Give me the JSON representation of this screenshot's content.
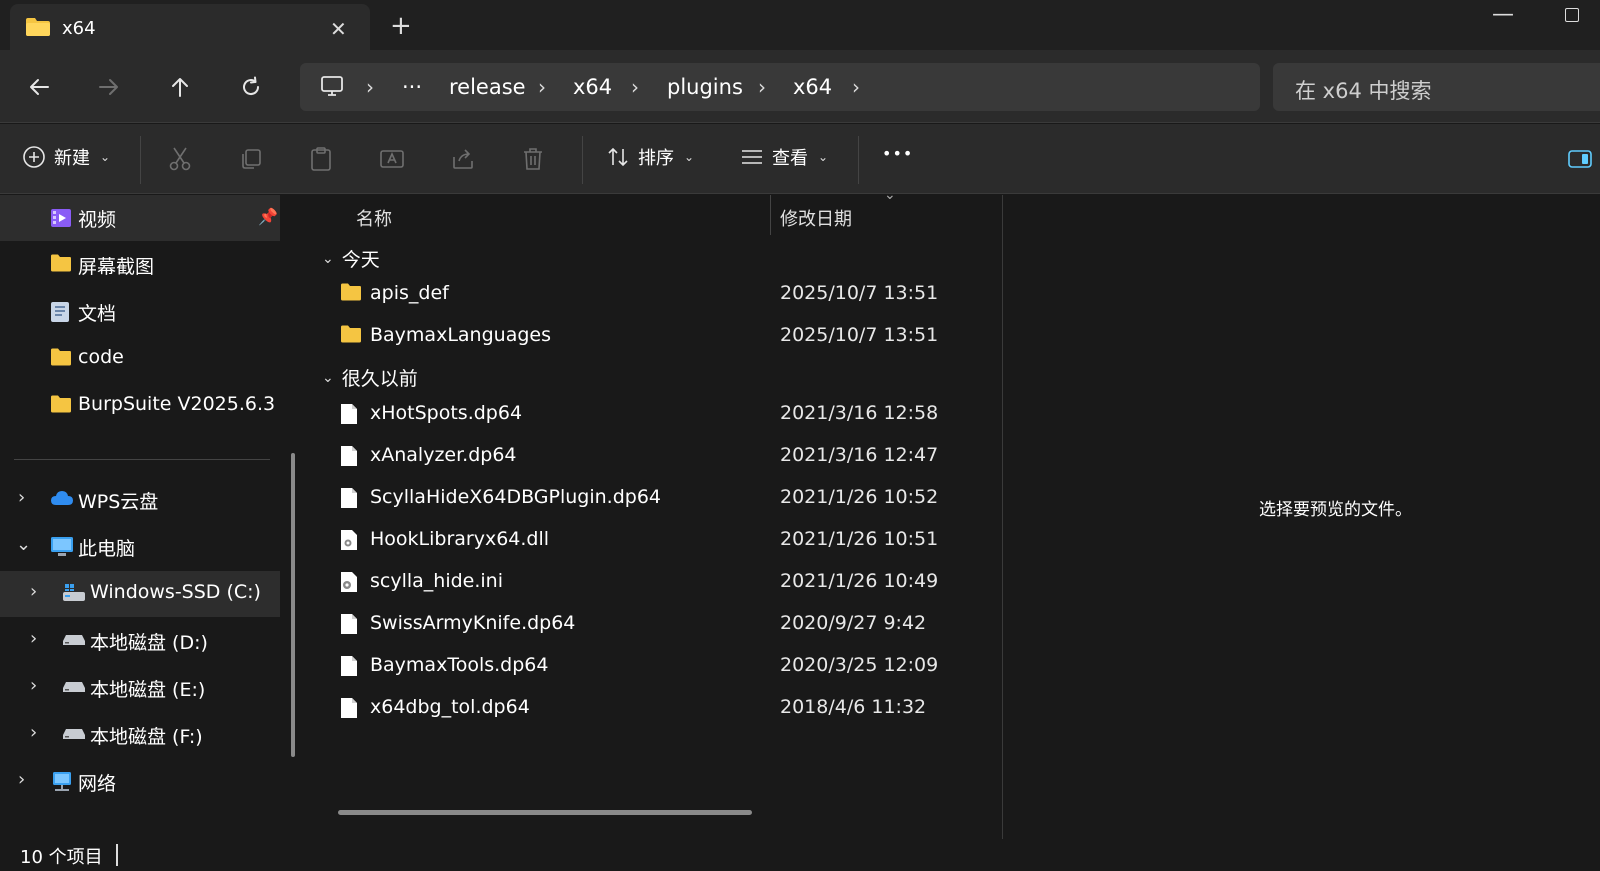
{
  "tab": {
    "title": "x64",
    "close": "✕",
    "new_tab": "+"
  },
  "window": {
    "minimize": "—"
  },
  "address": {
    "more": "···",
    "crumbs": [
      "release",
      "x64",
      "plugins",
      "x64"
    ],
    "sep": "›"
  },
  "search": {
    "placeholder": "在 x64 中搜索"
  },
  "toolbar": {
    "new_label": "新建",
    "sort_label": "排序",
    "view_label": "查看",
    "more_label": "•••"
  },
  "sidebar": {
    "quick": [
      {
        "label": "视频"
      },
      {
        "label": "屏幕截图"
      },
      {
        "label": "文档"
      },
      {
        "label": "code"
      },
      {
        "label": "BurpSuite V2025.6.3"
      }
    ],
    "tree": [
      {
        "label": "WPS云盘"
      },
      {
        "label": "此电脑"
      },
      {
        "label": "Windows-SSD (C:)"
      },
      {
        "label": "本地磁盘 (D:)"
      },
      {
        "label": "本地磁盘 (E:)"
      },
      {
        "label": "本地磁盘 (F:)"
      },
      {
        "label": "网络"
      }
    ]
  },
  "filelist": {
    "col_name": "名称",
    "col_date": "修改日期",
    "groups": [
      {
        "label": "今天"
      },
      {
        "label": "很久以前"
      }
    ],
    "rows": [
      {
        "name": "apis_def",
        "date": "2025/10/7 13:51",
        "icon": "folder-icon"
      },
      {
        "name": "BaymaxLanguages",
        "date": "2025/10/7 13:51",
        "icon": "folder-icon"
      },
      {
        "name": "xHotSpots.dp64",
        "date": "2021/3/16 12:58",
        "icon": "file-icon"
      },
      {
        "name": "xAnalyzer.dp64",
        "date": "2021/3/16 12:47",
        "icon": "file-icon"
      },
      {
        "name": "ScyllaHideX64DBGPlugin.dp64",
        "date": "2021/1/26 10:52",
        "icon": "file-icon"
      },
      {
        "name": "HookLibraryx64.dll",
        "date": "2021/1/26 10:51",
        "icon": "dll-file-icon"
      },
      {
        "name": "scylla_hide.ini",
        "date": "2021/1/26 10:49",
        "icon": "ini-file-icon"
      },
      {
        "name": "SwissArmyKnife.dp64",
        "date": "2020/9/27 9:42",
        "icon": "file-icon"
      },
      {
        "name": "BaymaxTools.dp64",
        "date": "2020/3/25 12:09",
        "icon": "file-icon"
      },
      {
        "name": "x64dbg_tol.dp64",
        "date": "2018/4/6 11:32",
        "icon": "file-icon"
      }
    ]
  },
  "preview": {
    "text": "选择要预览的文件。"
  },
  "status": {
    "text": "10 个项目"
  },
  "colors": {
    "accent": "#60cdff",
    "folder": "#f5c542",
    "bg": "#191919",
    "panel": "#2b2b2b"
  }
}
